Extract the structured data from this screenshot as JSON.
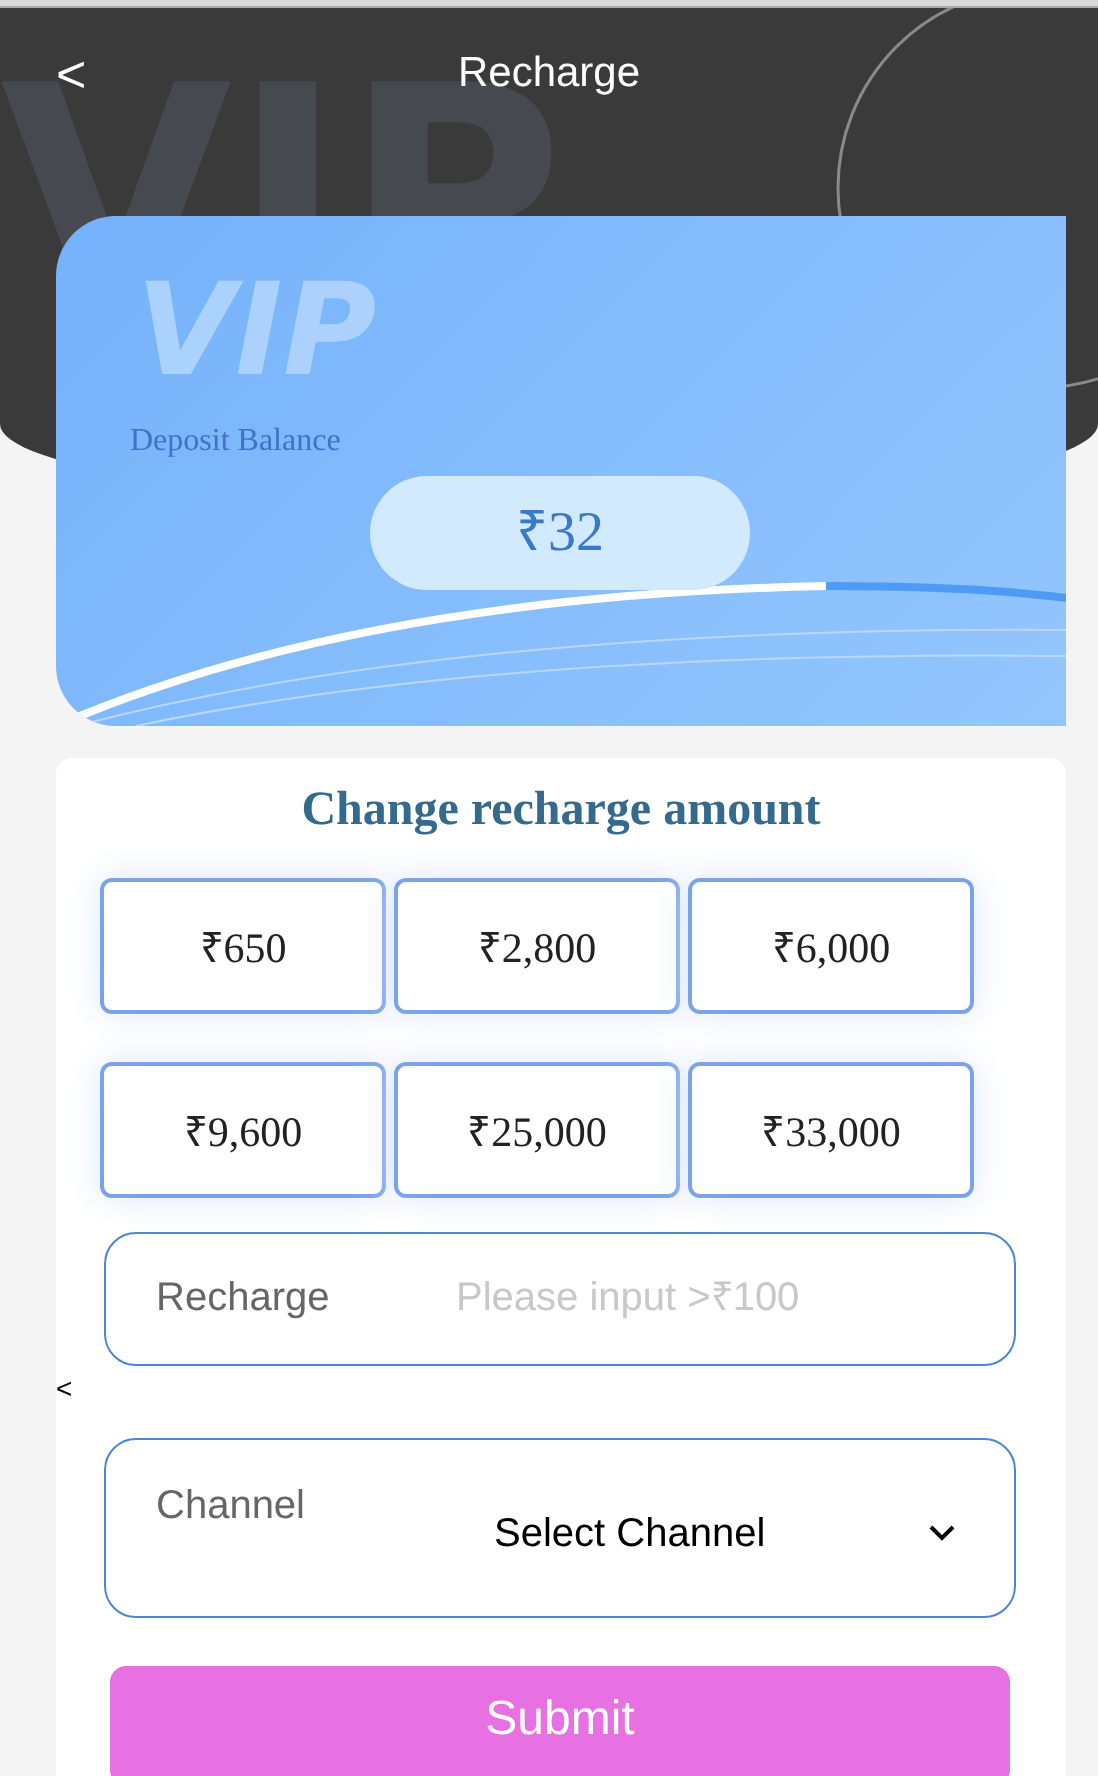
{
  "header": {
    "back_icon": "<",
    "title": "Recharge",
    "backdrop_text": "VIP"
  },
  "balance_card": {
    "logo_text": "VIP",
    "label": "Deposit Balance",
    "amount": "₹32"
  },
  "amount_panel": {
    "title": "Change recharge amount",
    "options": [
      "₹650",
      "₹2,800",
      "₹6,000",
      "₹9,600",
      "₹25,000",
      "₹33,000"
    ]
  },
  "recharge_field": {
    "label": "Recharge",
    "placeholder": "Please input >₹100"
  },
  "stray_mark": "<",
  "channel_field": {
    "label": "Channel",
    "value": "Select Channel"
  },
  "submit": "Submit"
}
